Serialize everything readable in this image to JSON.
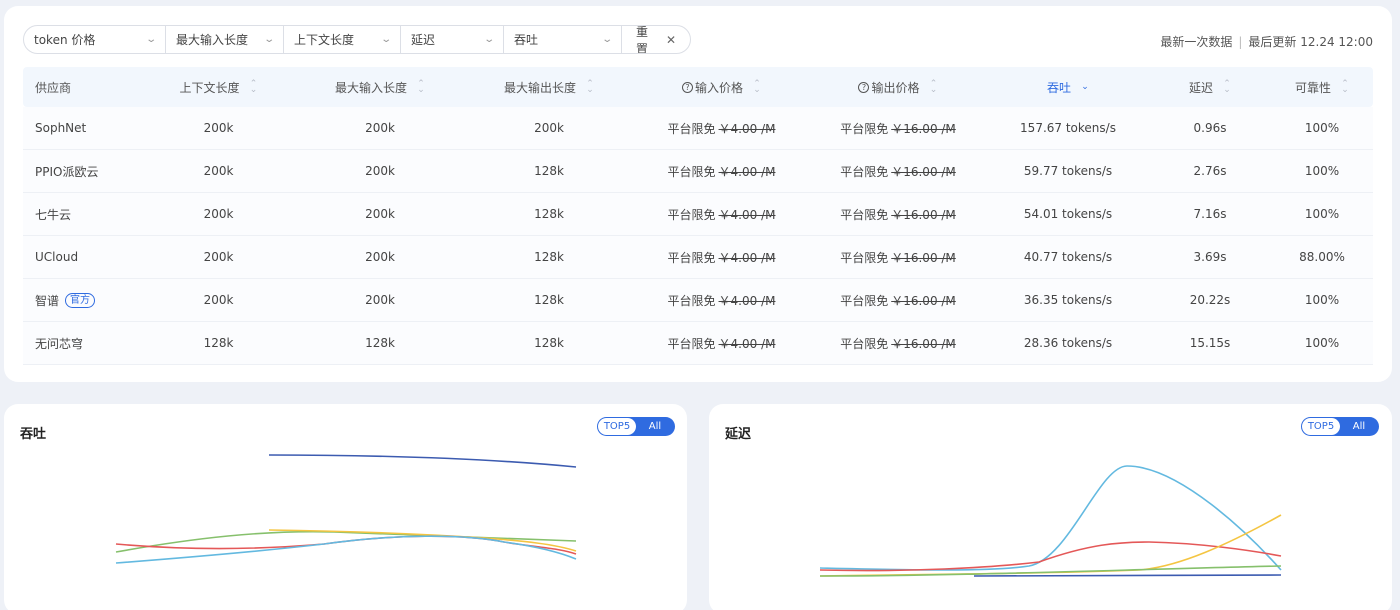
{
  "filters": [
    {
      "label": "token 价格"
    },
    {
      "label": "最大输入长度"
    },
    {
      "label": "上下文长度"
    },
    {
      "label": "延迟"
    },
    {
      "label": "吞吐"
    }
  ],
  "reset_label": "重置",
  "update": {
    "latest": "最新一次数据",
    "last_update": "最后更新 12.24 12:00"
  },
  "table": {
    "headers": [
      "供应商",
      "上下文长度",
      "最大输入长度",
      "最大输出长度",
      "输入价格",
      "输出价格",
      "吞吐",
      "延迟",
      "可靠性"
    ],
    "free_label": "平台限免",
    "rows": [
      {
        "provider": "SophNet",
        "context": "200k",
        "max_input": "200k",
        "max_output": "200k",
        "input_price": "￥4.00 /M",
        "output_price": "￥16.00 /M",
        "throughput": "157.67 tokens/s",
        "latency": "0.96s",
        "reliability": "100%"
      },
      {
        "provider": "PPIO派欧云",
        "context": "200k",
        "max_input": "200k",
        "max_output": "128k",
        "input_price": "￥4.00 /M",
        "output_price": "￥16.00 /M",
        "throughput": "59.77 tokens/s",
        "latency": "2.76s",
        "reliability": "100%"
      },
      {
        "provider": "七牛云",
        "context": "200k",
        "max_input": "200k",
        "max_output": "128k",
        "input_price": "￥4.00 /M",
        "output_price": "￥16.00 /M",
        "throughput": "54.01 tokens/s",
        "latency": "7.16s",
        "reliability": "100%"
      },
      {
        "provider": "UCloud",
        "context": "200k",
        "max_input": "200k",
        "max_output": "128k",
        "input_price": "￥4.00 /M",
        "output_price": "￥16.00 /M",
        "throughput": "40.77 tokens/s",
        "latency": "3.69s",
        "reliability": "88.00%"
      },
      {
        "provider": "智谱",
        "badge": "官方",
        "context": "200k",
        "max_input": "200k",
        "max_output": "128k",
        "input_price": "￥4.00 /M",
        "output_price": "￥16.00 /M",
        "throughput": "36.35 tokens/s",
        "latency": "20.22s",
        "reliability": "100%"
      },
      {
        "provider": "无问芯穹",
        "context": "128k",
        "max_input": "128k",
        "max_output": "128k",
        "input_price": "￥4.00 /M",
        "output_price": "￥16.00 /M",
        "throughput": "28.36 tokens/s",
        "latency": "15.15s",
        "reliability": "100%"
      }
    ]
  },
  "panels": {
    "throughput": {
      "title": "吞吐",
      "toggle": [
        "TOP5",
        "All"
      ],
      "selected": "TOP5"
    },
    "latency": {
      "title": "延迟",
      "toggle": [
        "TOP5",
        "All"
      ],
      "selected": "TOP5"
    }
  },
  "colors": {
    "accent": "#2f6be0",
    "navy": "#3c5bb0",
    "red": "#e45858",
    "green": "#86c06c",
    "yellow": "#f4c542",
    "sky": "#63b9e0"
  }
}
